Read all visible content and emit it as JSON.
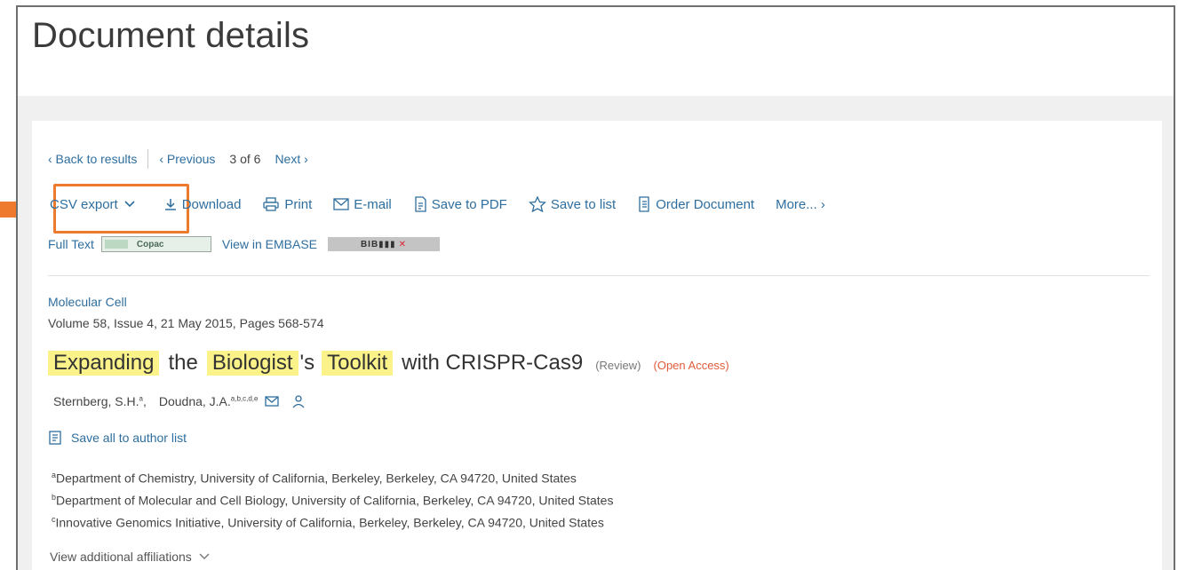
{
  "header": {
    "title": "Document details"
  },
  "nav": {
    "back": "‹ Back to results",
    "previous": "‹ Previous",
    "position": "3  of  6",
    "next": "Next ›"
  },
  "actions": {
    "csv_export": "CSV export",
    "download": "Download",
    "print": "Print",
    "email": "E-mail",
    "save_pdf": "Save to PDF",
    "save_list": "Save to list",
    "order": "Order Document",
    "more": "More... ›"
  },
  "fulltext": {
    "label": "Full Text",
    "copac": "Copac",
    "embase": "View in EMBASE",
    "bib": "BIB▮▮▮"
  },
  "document": {
    "journal": "Molecular Cell",
    "volume": "Volume 58, Issue 4, 21 May 2015, Pages 568-574",
    "title_parts": [
      "Expanding",
      "the",
      "Biologist",
      "'s",
      "Toolkit",
      "with CRISPR-Cas9"
    ],
    "review_tag": "(Review)",
    "oa_tag": "(Open Access)",
    "authors": [
      {
        "name": "Sternberg, S.H.",
        "sup": "a"
      },
      {
        "name": "Doudna, J.A.",
        "sup": "a,b,c,d,e"
      }
    ],
    "save_authors": "Save all to author list",
    "affiliations": [
      {
        "sup": "a",
        "text": "Department of Chemistry, University of California, Berkeley, Berkeley, CA 94720, United States"
      },
      {
        "sup": "b",
        "text": "Department of Molecular and Cell Biology, University of California, Berkeley, CA 94720, United States"
      },
      {
        "sup": "c",
        "text": "Innovative Genomics Initiative, University of California, Berkeley, Berkeley, CA 94720, United States"
      }
    ],
    "view_more_aff": "View additional affiliations"
  },
  "colors": {
    "link": "#2e6e9e",
    "highlight": "#fbf389",
    "callout": "#ee7a2d",
    "open_access": "#e05b3b"
  },
  "icons": [
    "download-icon",
    "print-icon",
    "email-icon",
    "pdf-icon",
    "star-icon",
    "order-icon",
    "chevron-down-icon",
    "person-icon",
    "author-list-icon",
    "arrow-icon"
  ]
}
